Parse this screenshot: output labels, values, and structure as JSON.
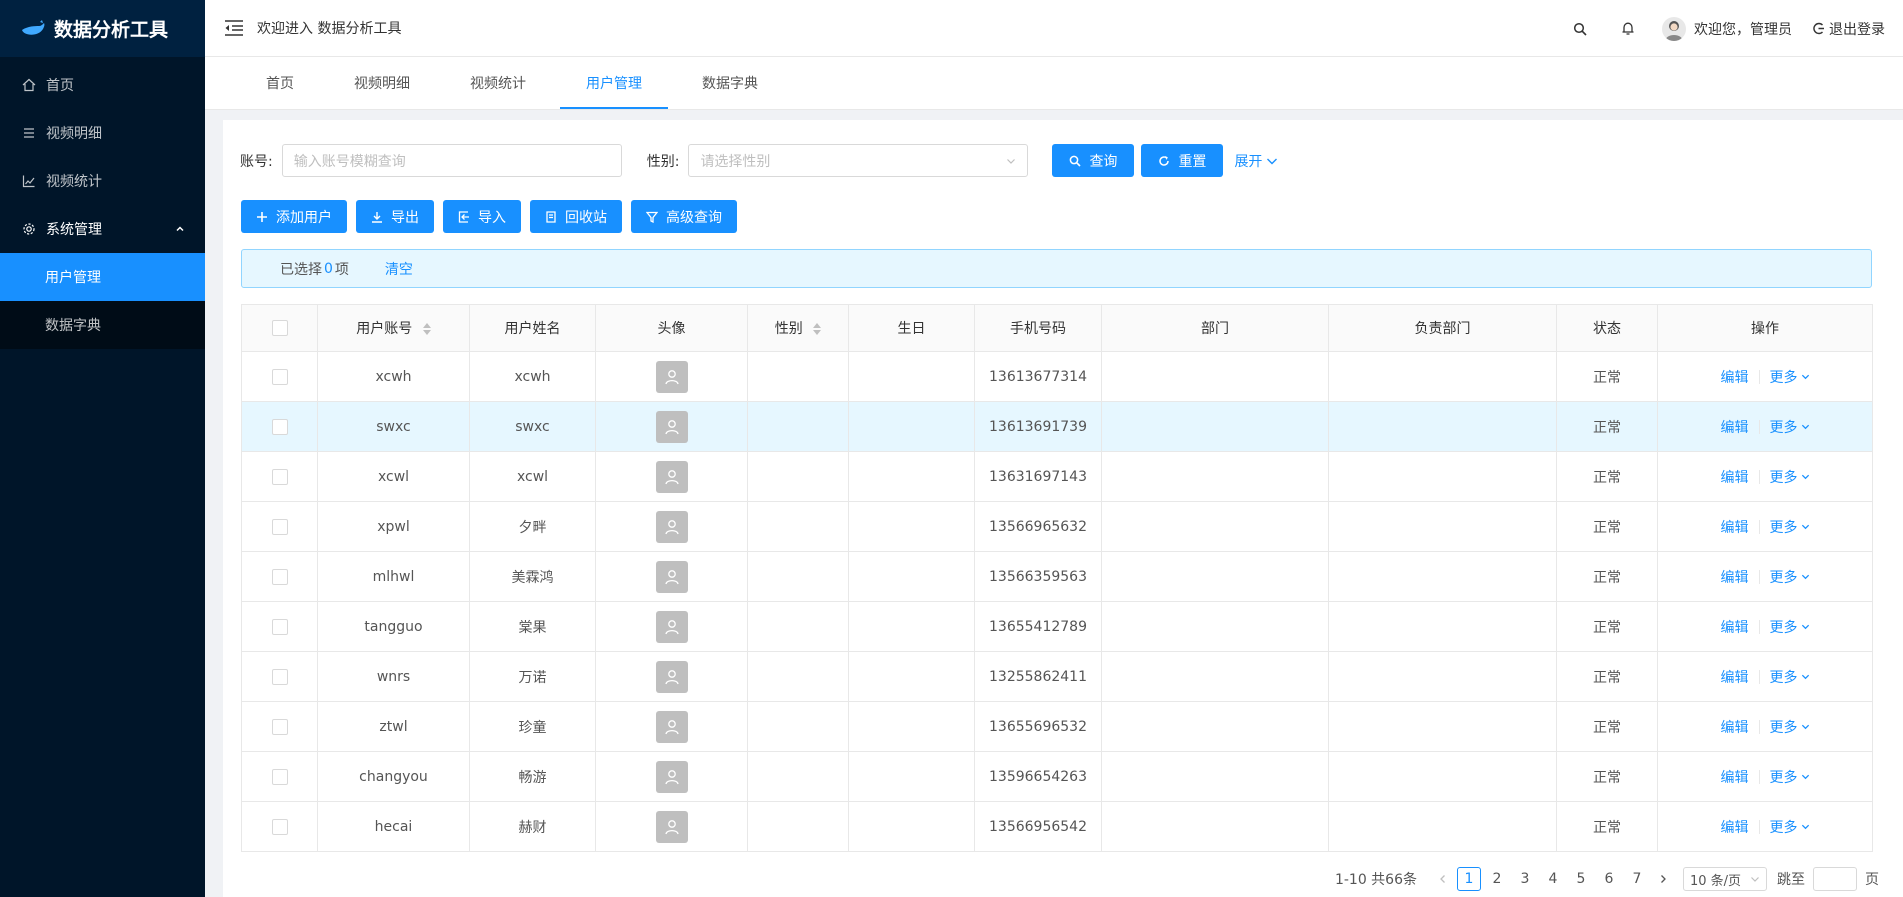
{
  "app": {
    "title": "数据分析工具"
  },
  "sidebar": {
    "items": [
      {
        "label": "首页",
        "icon": "home-icon"
      },
      {
        "label": "视频明细",
        "icon": "list-icon"
      },
      {
        "label": "视频统计",
        "icon": "line-chart-icon"
      },
      {
        "label": "系统管理",
        "icon": "gear-icon",
        "expanded": true,
        "children": [
          {
            "label": "用户管理",
            "active": true
          },
          {
            "label": "数据字典"
          }
        ]
      }
    ]
  },
  "header": {
    "welcome": "欢迎进入 数据分析工具",
    "user_greeting": "欢迎您，管理员",
    "logout": "退出登录"
  },
  "tabs": [
    {
      "label": "首页"
    },
    {
      "label": "视频明细"
    },
    {
      "label": "视频统计"
    },
    {
      "label": "用户管理",
      "active": true
    },
    {
      "label": "数据字典"
    }
  ],
  "search": {
    "account_label": "账号:",
    "account_placeholder": "输入账号模糊查询",
    "gender_label": "性别:",
    "gender_placeholder": "请选择性别",
    "query_btn": "查询",
    "reset_btn": "重置",
    "expand": "展开"
  },
  "toolbar": {
    "add": "添加用户",
    "export": "导出",
    "import": "导入",
    "recycle": "回收站",
    "advanced": "高级查询"
  },
  "selection": {
    "prefix": "已选择",
    "count": "0",
    "suffix": "项",
    "clear": "清空"
  },
  "table": {
    "columns": [
      "用户账号",
      "用户姓名",
      "头像",
      "性别",
      "生日",
      "手机号码",
      "部门",
      "负责部门",
      "状态",
      "操作"
    ],
    "edit_label": "编辑",
    "more_label": "更多",
    "rows": [
      {
        "account": "xcwh",
        "name": "xcwh",
        "gender": "",
        "birthday": "",
        "phone": "13613677314",
        "dept": "",
        "manage_dept": "",
        "status": "正常"
      },
      {
        "account": "swxc",
        "name": "swxc",
        "gender": "",
        "birthday": "",
        "phone": "13613691739",
        "dept": "",
        "manage_dept": "",
        "status": "正常"
      },
      {
        "account": "xcwl",
        "name": "xcwl",
        "gender": "",
        "birthday": "",
        "phone": "13631697143",
        "dept": "",
        "manage_dept": "",
        "status": "正常"
      },
      {
        "account": "xpwl",
        "name": "夕畔",
        "gender": "",
        "birthday": "",
        "phone": "13566965632",
        "dept": "",
        "manage_dept": "",
        "status": "正常"
      },
      {
        "account": "mlhwl",
        "name": "美霖鸿",
        "gender": "",
        "birthday": "",
        "phone": "13566359563",
        "dept": "",
        "manage_dept": "",
        "status": "正常"
      },
      {
        "account": "tangguo",
        "name": "棠果",
        "gender": "",
        "birthday": "",
        "phone": "13655412789",
        "dept": "",
        "manage_dept": "",
        "status": "正常"
      },
      {
        "account": "wnrs",
        "name": "万诺",
        "gender": "",
        "birthday": "",
        "phone": "13255862411",
        "dept": "",
        "manage_dept": "",
        "status": "正常"
      },
      {
        "account": "ztwl",
        "name": "珍童",
        "gender": "",
        "birthday": "",
        "phone": "13655696532",
        "dept": "",
        "manage_dept": "",
        "status": "正常"
      },
      {
        "account": "changyou",
        "name": "畅游",
        "gender": "",
        "birthday": "",
        "phone": "13596654263",
        "dept": "",
        "manage_dept": "",
        "status": "正常"
      },
      {
        "account": "hecai",
        "name": "赫财",
        "gender": "",
        "birthday": "",
        "phone": "13566956542",
        "dept": "",
        "manage_dept": "",
        "status": "正常"
      }
    ]
  },
  "pagination": {
    "total_text": "1-10 共66条",
    "pages": [
      "1",
      "2",
      "3",
      "4",
      "5",
      "6",
      "7"
    ],
    "current": "1",
    "page_size": "10 条/页",
    "jump_label": "跳至",
    "page_unit": "页"
  },
  "colors": {
    "primary": "#1890ff",
    "sidebar_bg": "#001529",
    "highlight_row": "#e6f7ff"
  }
}
